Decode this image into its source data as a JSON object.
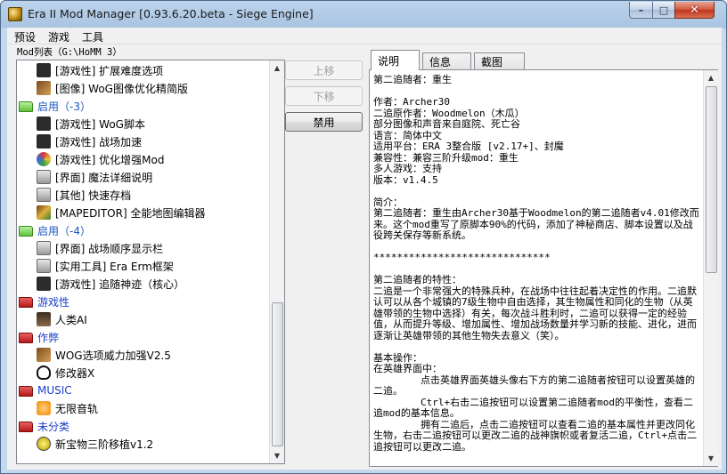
{
  "window": {
    "title": "Era II Mod Manager [0.93.6.20.beta - Siege Engine]",
    "controls": {
      "minimize": "–",
      "maximize": "□",
      "close": "✕"
    }
  },
  "menu": [
    "预设",
    "游戏",
    "工具"
  ],
  "mod_list": {
    "label": "Mod列表（G:\\HoMM 3）",
    "rows": [
      {
        "type": "mod",
        "text": "[游戏性] 扩展难度选项",
        "icon": "fighter-icon"
      },
      {
        "type": "mod",
        "text": "[图像] WoG图像优化精简版",
        "icon": "wog-icon"
      },
      {
        "type": "category",
        "text": "启用（-3）",
        "icon": "green-folder-icon"
      },
      {
        "type": "mod",
        "text": "[游戏性] WoG脚本",
        "icon": "wog-script-icon"
      },
      {
        "type": "mod",
        "text": "[游戏性] 战场加速",
        "icon": "runner-icon"
      },
      {
        "type": "mod",
        "text": "[游戏性] 优化增强Mod",
        "icon": "colorful-icon"
      },
      {
        "type": "mod",
        "text": "[界面] 魔法详细说明",
        "icon": "window-icon"
      },
      {
        "type": "mod",
        "text": "[其他] 快速存档",
        "icon": "save-icon"
      },
      {
        "type": "mod",
        "text": "[MAPEDITOR] 全能地图编辑器",
        "icon": "map-icon"
      },
      {
        "type": "category",
        "text": "启用（-4）",
        "icon": "green-folder-icon"
      },
      {
        "type": "mod",
        "text": "[界面] 战场顺序显示栏",
        "icon": "queue-icon"
      },
      {
        "type": "mod",
        "text": "[实用工具] Era Erm框架",
        "icon": "window-icon"
      },
      {
        "type": "mod",
        "text": "[游戏性] 追随神迹（核心）",
        "icon": "wog-script-icon"
      },
      {
        "type": "category_red",
        "text": "游戏性",
        "icon": "red-folder-icon"
      },
      {
        "type": "mod",
        "text": "人类AI",
        "icon": "hero-icon"
      },
      {
        "type": "category_red",
        "text": "作弊",
        "icon": "red-folder-icon"
      },
      {
        "type": "mod",
        "text": "WOG选项威力加强V2.5",
        "icon": "wog-icon"
      },
      {
        "type": "mod",
        "text": "修改器X",
        "icon": "skull-icon"
      },
      {
        "type": "category_red",
        "text": "MUSIC",
        "icon": "red-folder-icon"
      },
      {
        "type": "mod",
        "text": "无限音轨",
        "icon": "music-icon"
      },
      {
        "type": "category_red",
        "text": "未分类",
        "icon": "red-folder-icon"
      },
      {
        "type": "mod",
        "text": "新宝物三阶移植v1.2",
        "icon": "gem-icon"
      }
    ]
  },
  "buttons": {
    "move_up": "上移",
    "move_down": "下移",
    "disable": "禁用"
  },
  "tabs": [
    "说明",
    "信息",
    "截图"
  ],
  "description": "第二追随者：重生\n\n作者：Archer30\n二追原作者：Woodmelon（木瓜）\n部分图像和声音来自庭院、死亡谷\n语言：简体中文\n适用平台：ERA 3整合版 [v2.17+]、封魔\n兼容性：兼容三阶升级mod：重生\n多人游戏：支持\n版本：v1.4.5\n\n简介：\n第二追随者：重生由Archer30基于Woodmelon的第二追随者v4.01修改而来。这个mod重写了原脚本90%的代码，添加了神秘商店、脚本设置以及战役跨关保存等新系统。\n\n******************************\n\n第二追随者的特性：\n二追是一个非常强大的特殊兵种，在战场中往往起着决定性的作用。二追默认可以从各个城镇的7级生物中自由选择，其生物属性和同化的生物（从英雄带领的生物中选择）有关，每次战斗胜利时，二追可以获得一定的经验值，从而提升等级、增加属性、增加战场数量并学习新的技能、进化，进而逐渐让英雄带领的其他生物失去意义（笑）。\n\n基本操作：\n在英雄界面中：\n        点击英雄界面英雄头像右下方的第二追随者按钮可以设置英雄的二追。\n        Ctrl+右击二追按钮可以设置第二追随者mod的平衡性，查看二追mod的基本信息。\n        拥有二追后，点击二追按钮可以查看二追的基本属性并更改同化生物，右击二追按钮可以更改二追的战神旗帜或者复活二追，Ctrl+点击二追按钮可以更改二追。\n\n在英雄交换界面中："
}
